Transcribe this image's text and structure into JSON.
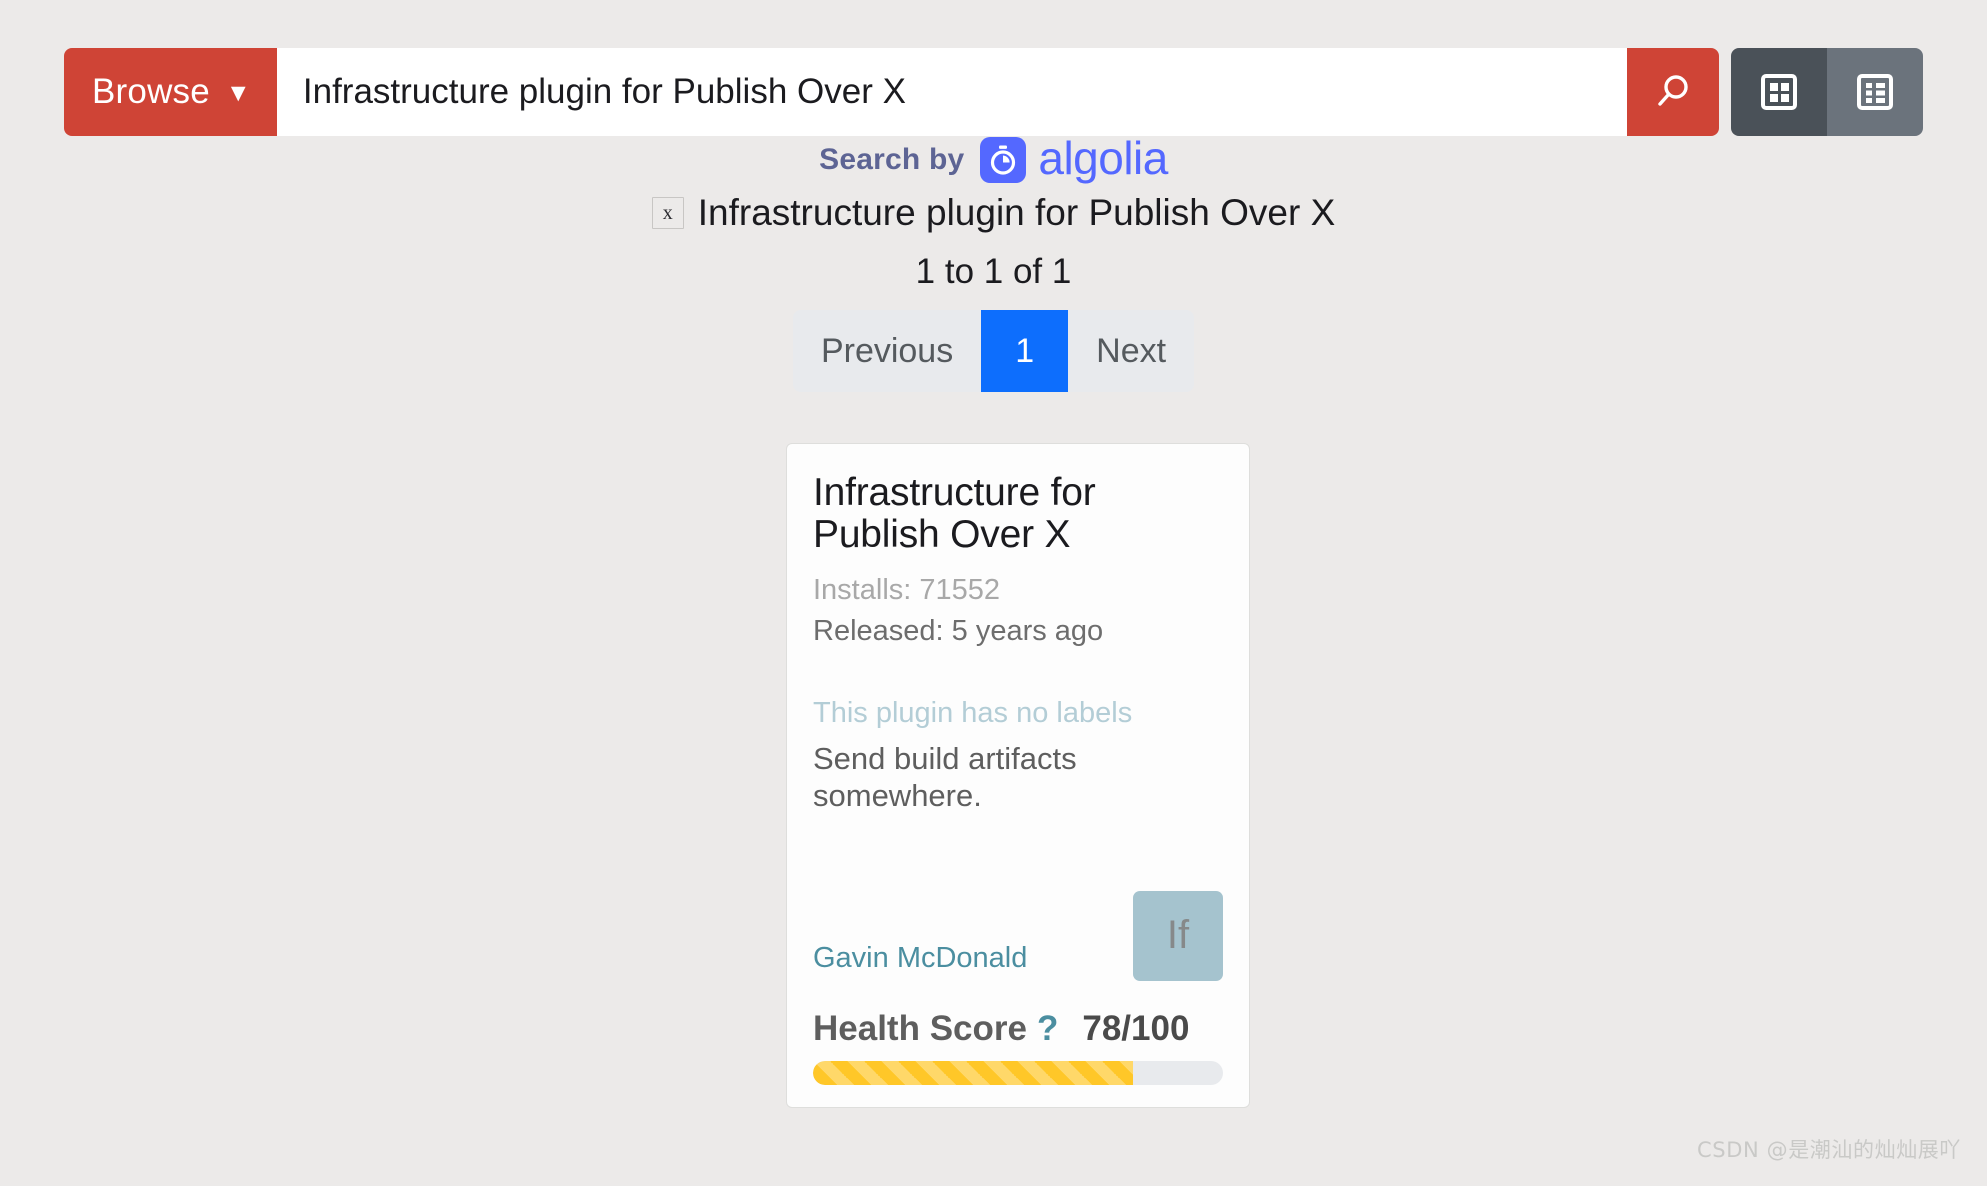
{
  "toolbar": {
    "browse_label": "Browse",
    "browse_caret": "▼",
    "search_value": "Infrastructure plugin for Publish Over X",
    "search_placeholder": "Search",
    "search_icon": "search-icon",
    "view_grid_icon": "grid-view-icon",
    "view_table_icon": "table-view-icon",
    "accent_red": "#cf4436",
    "view_active_bg": "#4a5158",
    "view_inactive_bg": "#6b737c"
  },
  "algolia": {
    "search_by": "Search by",
    "brand": "algolia",
    "mark_icon": "algolia-stopwatch-icon",
    "brand_color": "#5468ff",
    "text_color": "#5d6494"
  },
  "query": {
    "clear_label": "x",
    "text": "Infrastructure plugin for Publish Over X",
    "result_count": "1 to 1 of 1"
  },
  "pagination": {
    "previous": "Previous",
    "next": "Next",
    "pages": [
      "1"
    ],
    "current": "1",
    "active_color": "#0d6efd"
  },
  "plugin_card": {
    "title": "Infrastructure for Publish Over X",
    "installs": "Installs: 71552",
    "released": "Released: 5 years ago",
    "labels_text": "This plugin has no labels",
    "description": "Send build artifacts somewhere.",
    "author": "Gavin McDonald",
    "avatar_initials": "If",
    "avatar_color": "#a5c3ce",
    "health_label": "Health Score",
    "health_help": "?",
    "health_value": "78/100",
    "health_percent": 78,
    "health_bar_color": "#ffc728"
  },
  "watermark": {
    "text": "CSDN @是潮汕的灿灿展吖"
  }
}
